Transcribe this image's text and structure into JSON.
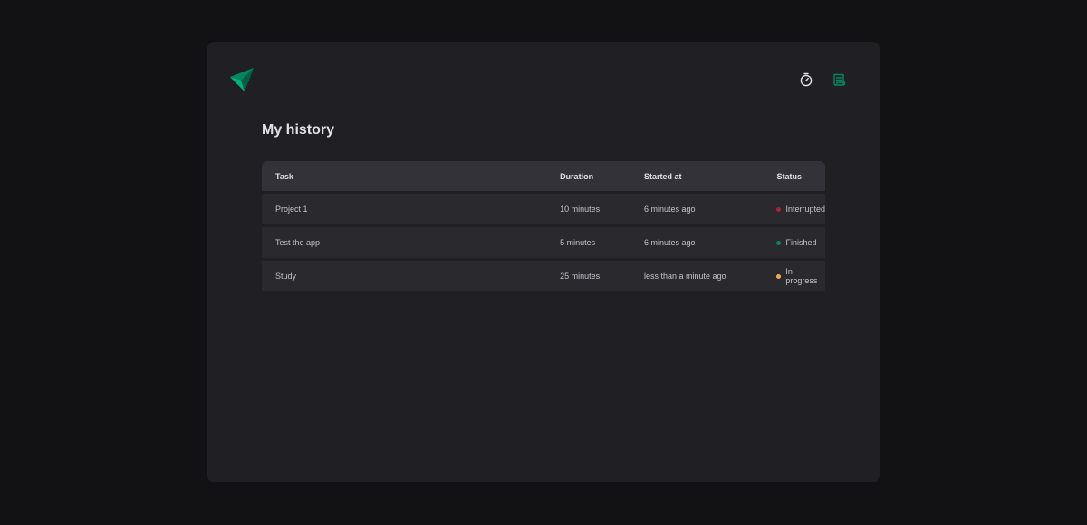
{
  "app": {
    "colors": {
      "page_bg": "#121214",
      "panel_bg": "#202024",
      "accent": "#00875f"
    }
  },
  "header": {
    "logo_icon": "paper-plane-logo-icon",
    "nav": [
      {
        "icon": "timer-icon",
        "active": false
      },
      {
        "icon": "scroll-history-icon",
        "active": true
      }
    ]
  },
  "page": {
    "title": "My history"
  },
  "table": {
    "headers": {
      "task": "Task",
      "duration": "Duration",
      "started_at": "Started at",
      "status": "Status"
    },
    "rows": [
      {
        "task": "Project 1",
        "duration": "10 minutes",
        "started_at": "6 minutes ago",
        "status": "Interrupted",
        "status_color": "#ab222e"
      },
      {
        "task": "Test the app",
        "duration": "5 minutes",
        "started_at": "6 minutes ago",
        "status": "Finished",
        "status_color": "#00875f"
      },
      {
        "task": "Study",
        "duration": "25 minutes",
        "started_at": "less than a minute ago",
        "status": "In progress",
        "status_color": "#fba94c"
      }
    ]
  }
}
